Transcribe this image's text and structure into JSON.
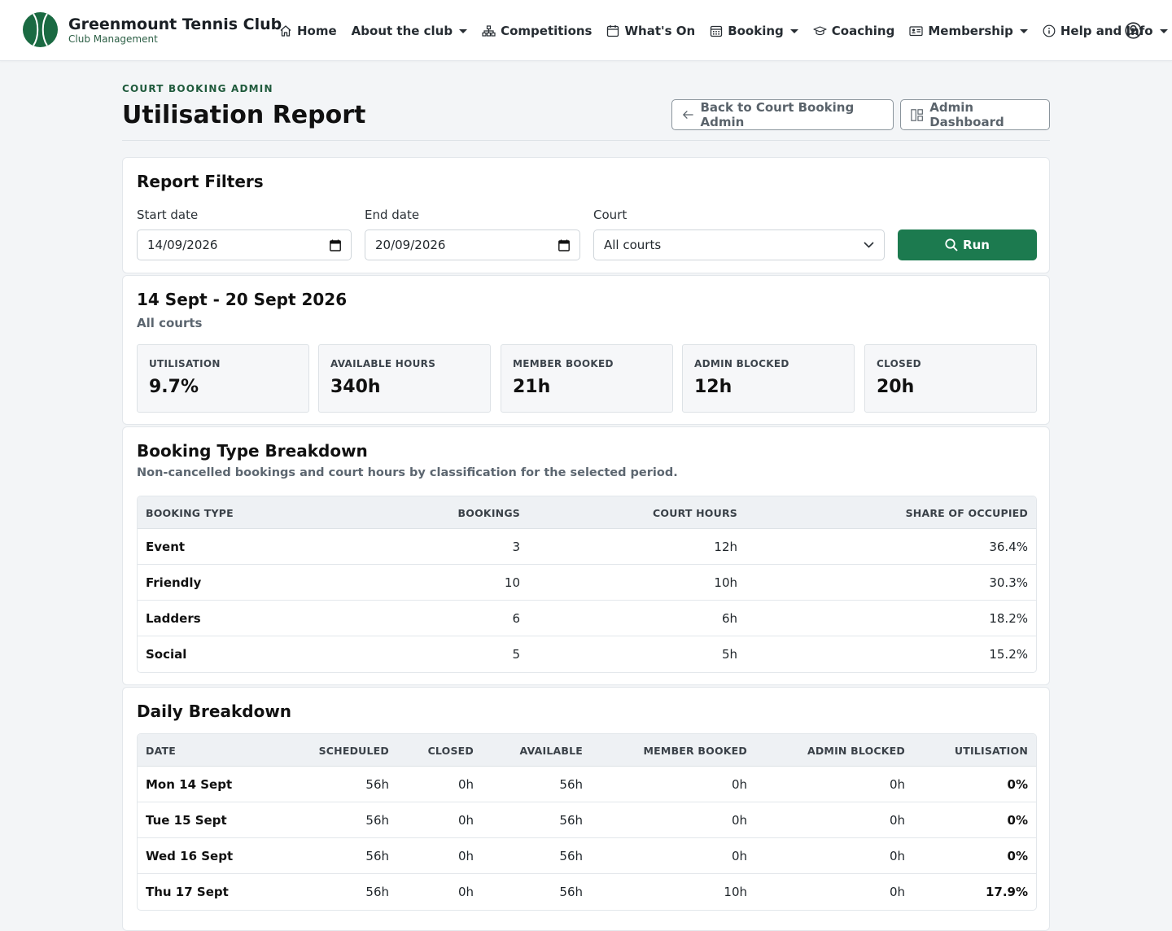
{
  "nav": {
    "brand_title": "Greenmount Tennis Club",
    "brand_sub": "Club Management",
    "items": [
      {
        "label": "Home",
        "icon": "home-icon",
        "dropdown": false
      },
      {
        "label": "About the club",
        "icon": "",
        "dropdown": true
      },
      {
        "label": "Competitions",
        "icon": "sitemap-icon",
        "dropdown": false
      },
      {
        "label": "What's On",
        "icon": "calendar-icon",
        "dropdown": false
      },
      {
        "label": "Booking",
        "icon": "calendar-grid-icon",
        "dropdown": true
      },
      {
        "label": "Coaching",
        "icon": "graduation-cap-icon",
        "dropdown": false
      },
      {
        "label": "Membership",
        "icon": "id-card-icon",
        "dropdown": true
      },
      {
        "label": "Help and Info",
        "icon": "info-icon",
        "dropdown": true
      }
    ]
  },
  "header": {
    "eyebrow": "COURT BOOKING ADMIN",
    "title": "Utilisation Report",
    "back_label": "Back to Court Booking Admin",
    "dashboard_label": "Admin Dashboard"
  },
  "filters": {
    "title": "Report Filters",
    "start_label": "Start date",
    "start_value": "14/09/2026",
    "end_label": "End date",
    "end_value": "20/09/2026",
    "court_label": "Court",
    "court_value": "All courts",
    "run_label": "Run"
  },
  "summary": {
    "period": "14 Sept - 20 Sept 2026",
    "scope": "All courts",
    "stats": [
      {
        "label": "UTILISATION",
        "value": "9.7%"
      },
      {
        "label": "AVAILABLE HOURS",
        "value": "340h"
      },
      {
        "label": "MEMBER BOOKED",
        "value": "21h"
      },
      {
        "label": "ADMIN BLOCKED",
        "value": "12h"
      },
      {
        "label": "CLOSED",
        "value": "20h"
      }
    ]
  },
  "booking_types": {
    "title": "Booking Type Breakdown",
    "description": "Non-cancelled bookings and court hours by classification for the selected period.",
    "columns": [
      "BOOKING TYPE",
      "BOOKINGS",
      "COURT HOURS",
      "SHARE OF OCCUPIED"
    ],
    "rows": [
      [
        "Event",
        "3",
        "12h",
        "36.4%"
      ],
      [
        "Friendly",
        "10",
        "10h",
        "30.3%"
      ],
      [
        "Ladders",
        "6",
        "6h",
        "18.2%"
      ],
      [
        "Social",
        "5",
        "5h",
        "15.2%"
      ]
    ]
  },
  "daily": {
    "title": "Daily Breakdown",
    "columns": [
      "DATE",
      "SCHEDULED",
      "CLOSED",
      "AVAILABLE",
      "MEMBER BOOKED",
      "ADMIN BLOCKED",
      "UTILISATION"
    ],
    "rows": [
      [
        "Mon 14 Sept",
        "56h",
        "0h",
        "56h",
        "0h",
        "0h",
        "0%"
      ],
      [
        "Tue 15 Sept",
        "56h",
        "0h",
        "56h",
        "0h",
        "0h",
        "0%"
      ],
      [
        "Wed 16 Sept",
        "56h",
        "0h",
        "56h",
        "0h",
        "0h",
        "0%"
      ],
      [
        "Thu 17 Sept",
        "56h",
        "0h",
        "56h",
        "10h",
        "0h",
        "17.9%"
      ]
    ]
  },
  "colors": {
    "brand_green": "#1a6a42",
    "run_button": "#1c7a4f",
    "page_bg": "#f3f5f7"
  }
}
